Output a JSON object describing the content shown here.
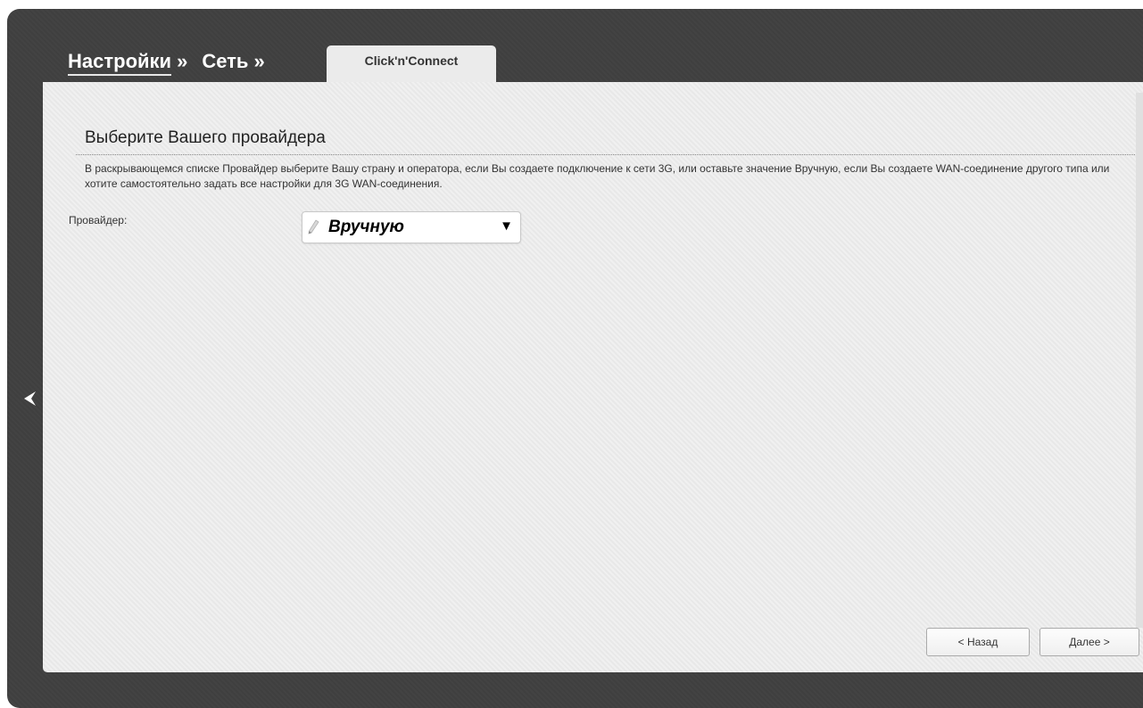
{
  "breadcrumb": {
    "items": [
      "Настройки",
      "Сеть"
    ],
    "separator": "»"
  },
  "tab": {
    "label": "Click'n'Connect"
  },
  "section": {
    "title": "Выберите Вашего провайдера",
    "description": "В раскрывающемся списке Провайдер выберите Вашу страну и оператора, если Вы создаете подключение к сети 3G, или оставьте значение Вручную, если Вы создаете WAN-соединение другого типа или хотите самостоятельно задать все настройки для 3G WAN-соединения."
  },
  "provider": {
    "label": "Провайдер:",
    "selected": "Вручную",
    "icon": "pencil-icon"
  },
  "buttons": {
    "back": "< Назад",
    "next": "Далее >"
  },
  "nav": {
    "collapse_icon": "chevron-left-icon"
  },
  "colors": {
    "frame": "#404040",
    "panel": "#ebebeb",
    "text": "#333333"
  }
}
